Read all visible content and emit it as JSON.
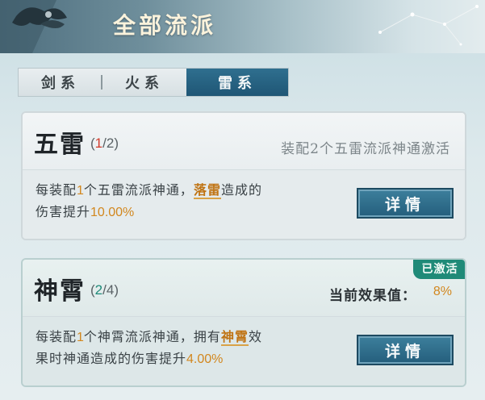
{
  "header": {
    "title": "全部流派"
  },
  "tabs": [
    {
      "label": "剑系",
      "active": false
    },
    {
      "label": "火系",
      "active": false
    },
    {
      "label": "雷系",
      "active": true
    }
  ],
  "cards": [
    {
      "name": "五雷",
      "count_current": "1",
      "count_total": "/2)",
      "count_open": "(",
      "hint": "装配2个五雷流派神通激活",
      "desc_line1_a": "每装配",
      "desc_line1_num": "1",
      "desc_line1_b": "个五雷流派神通，",
      "desc_line1_kw": "落雷",
      "desc_line1_c": "造成的",
      "desc_line2_a": "伤害提升",
      "desc_line2_num": "10.00%",
      "detail_label": "详情",
      "colors": {
        "count_current": "#d23a2a"
      }
    },
    {
      "name": "神霄",
      "count_current": "2",
      "count_total": "/4)",
      "count_open": "(",
      "badge": "已激活",
      "effect_label": "当前效果值：",
      "effect_value": "8%",
      "desc_line1_a": "每装配",
      "desc_line1_num": "1",
      "desc_line1_b": "个神霄流派神通，拥有",
      "desc_line1_kw": "神霄",
      "desc_line1_c": "效",
      "desc_line2_a": "果时神通造成的伤害提升",
      "desc_line2_num": "4.00%",
      "detail_label": "详情",
      "colors": {
        "count_current": "#1f8a78"
      }
    }
  ]
}
